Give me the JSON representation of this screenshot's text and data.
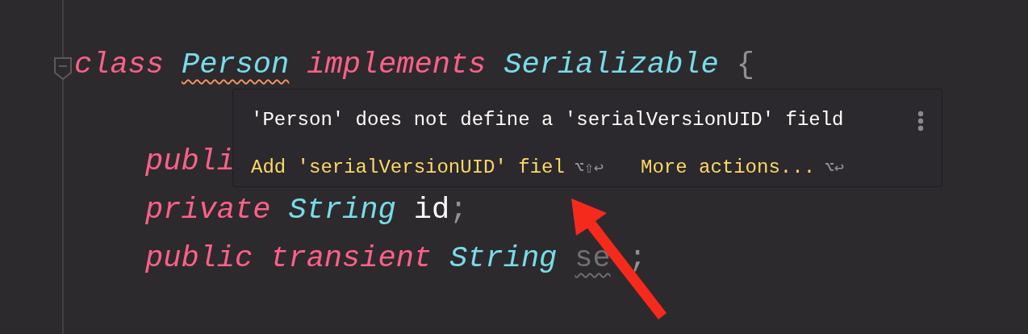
{
  "editor": {
    "class_header": {
      "folded": false,
      "tokens": [
        {
          "text": "class",
          "kind": "keyword"
        },
        {
          "text": "Person",
          "kind": "type",
          "squiggle": true
        },
        {
          "text": "implements",
          "kind": "keyword"
        },
        {
          "text": "Serializable",
          "kind": "type"
        },
        {
          "text": "{",
          "kind": "punct"
        }
      ]
    },
    "body_lines": [
      {
        "tokens": [
          {
            "text": "publi",
            "kind": "keyword"
          }
        ]
      },
      {
        "tokens": [
          {
            "text": "private",
            "kind": "keyword"
          },
          {
            "text": "String",
            "kind": "type"
          },
          {
            "text": "id",
            "kind": "ident"
          },
          {
            "text": ";",
            "kind": "punct"
          }
        ]
      },
      {
        "tokens": [
          {
            "text": "public",
            "kind": "keyword"
          },
          {
            "text": "transient",
            "kind": "keyword"
          },
          {
            "text": "String",
            "kind": "type"
          },
          {
            "text": "se",
            "kind": "unused",
            "squiggle": true
          },
          {
            "text": ";",
            "kind": "punct"
          }
        ]
      }
    ]
  },
  "popup": {
    "message": "'Person' does not define a 'serialVersionUID' field",
    "actions": [
      {
        "label": "Add 'serialVersionUID' fiel",
        "shortcut": "⌥⇧↩"
      },
      {
        "label": "More actions...",
        "shortcut": "⌥↩"
      }
    ]
  }
}
